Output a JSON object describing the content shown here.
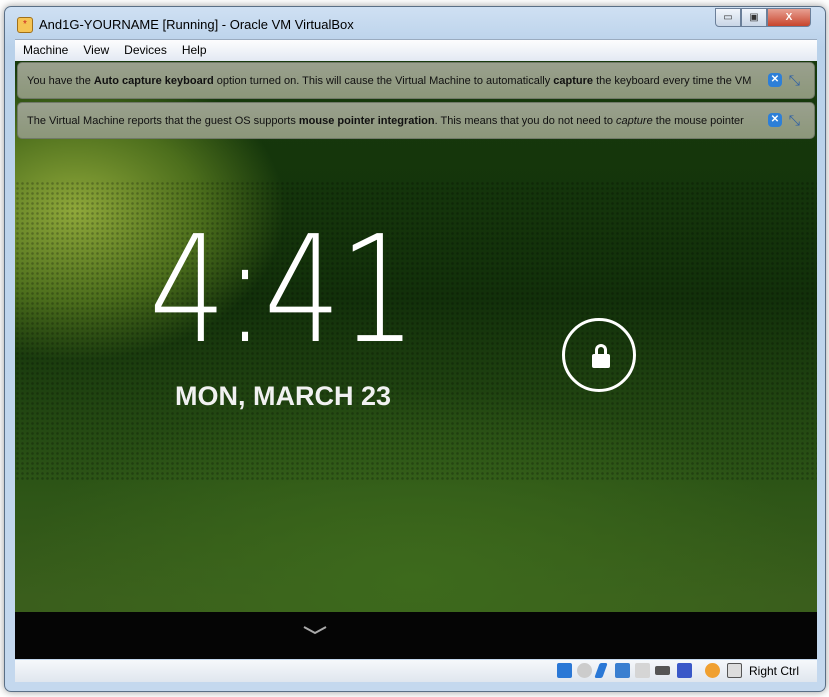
{
  "window": {
    "title": "And1G-YOURNAME [Running] - Oracle VM VirtualBox",
    "minimize": "▭",
    "maximize": "▣",
    "close": "X"
  },
  "menu": [
    "Machine",
    "View",
    "Devices",
    "Help"
  ],
  "notices": [
    {
      "parts": [
        {
          "t": "You have the "
        },
        {
          "t": "Auto capture keyboard",
          "b": true
        },
        {
          "t": " option turned on. This will cause the Virtual Machine to automatically "
        },
        {
          "t": "capture",
          "b": true
        },
        {
          "t": " the keyboard every time the VM"
        }
      ]
    },
    {
      "parts": [
        {
          "t": "The Virtual Machine reports that the guest OS supports "
        },
        {
          "t": "mouse pointer integration",
          "b": true
        },
        {
          "t": ". This means that you do not need to "
        },
        {
          "t": "capture",
          "i": true
        },
        {
          "t": " the mouse pointer"
        }
      ]
    }
  ],
  "lockscreen": {
    "time": "4:41",
    "date": "MON, MARCH 23"
  },
  "status": {
    "host_key": "Right Ctrl",
    "icons": [
      "hard-disk-icon",
      "optical-drive-icon",
      "usb-icon",
      "network-icon",
      "shared-folders-icon",
      "video-capture-icon",
      "cpu-virtualization-icon",
      "mouse-integration-icon",
      "keyboard-capture-icon"
    ]
  }
}
